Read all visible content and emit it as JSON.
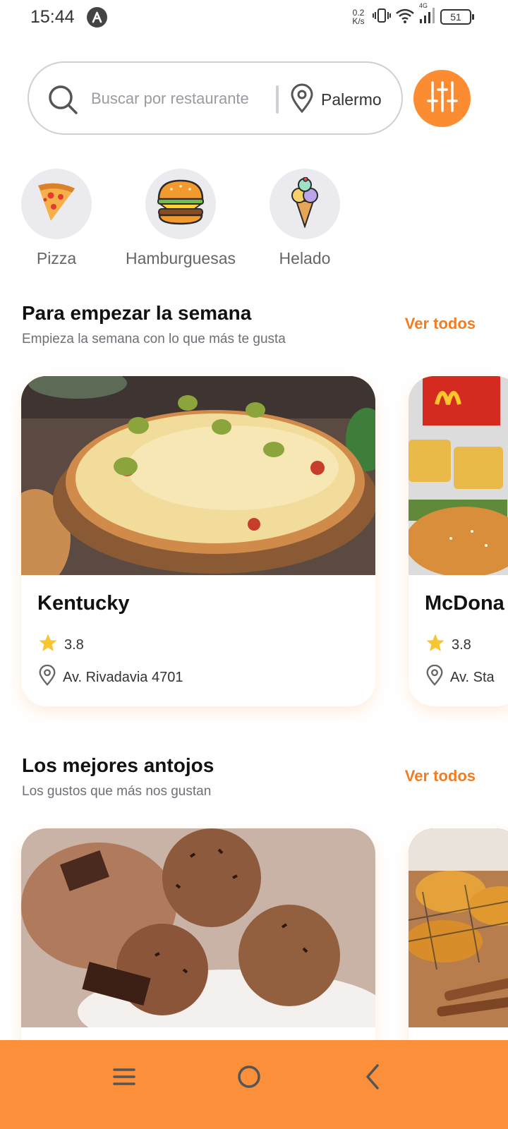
{
  "status_bar": {
    "time": "15:44",
    "net_speed_value": "0.2",
    "net_speed_unit": "K/s",
    "network_type": "4G",
    "battery": "51"
  },
  "search": {
    "placeholder": "Buscar por restaurante",
    "location": "Palermo"
  },
  "categories": [
    {
      "label": "Pizza",
      "icon": "pizza-icon"
    },
    {
      "label": "Hamburguesas",
      "icon": "burger-icon"
    },
    {
      "label": "Helado",
      "icon": "ice-cream-icon"
    }
  ],
  "sections": [
    {
      "title": "Para empezar la semana",
      "subtitle": "Empieza la semana con lo que más te gusta",
      "see_all": "Ver todos",
      "cards": [
        {
          "name": "Kentucky",
          "rating": "3.8",
          "address": "Av. Rivadavia 4701",
          "image": "pizza-photo"
        },
        {
          "name": "McDona",
          "rating": "3.8",
          "address": "Av. Sta",
          "image": "mcdonalds-photo"
        }
      ]
    },
    {
      "title": "Los mejores antojos",
      "subtitle": "Los gustos que más nos gustan",
      "see_all": "Ver todos",
      "cards": [
        {
          "image": "chocolate-ice-cream-photo"
        },
        {
          "image": "croissants-photo"
        }
      ]
    }
  ],
  "colors": {
    "accent": "#fb8c32",
    "link": "#f17d22",
    "nav_bar": "#fb8f3a",
    "star": "#f7c531"
  },
  "nav_bar": {
    "icons": [
      "menu-icon",
      "home-icon",
      "back-icon"
    ]
  }
}
